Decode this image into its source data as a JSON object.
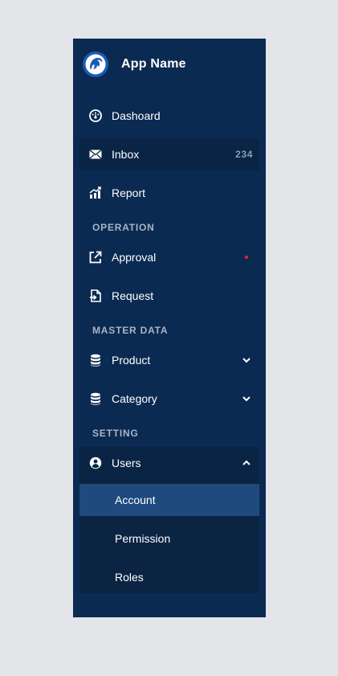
{
  "brand": {
    "name": "App Name",
    "logo_icon": "dolphin-logo-icon"
  },
  "colors": {
    "sidebar_bg": "#0b2a52",
    "active_bg": "#0a2445",
    "selected_bg": "#1e4a80",
    "badge_dot": "#e02a2a",
    "page_bg": "#e4e5e9"
  },
  "nav": {
    "dashboard": {
      "label": "Dashoard",
      "icon": "dashboard-gauge-icon"
    },
    "inbox": {
      "label": "Inbox",
      "count": "234",
      "icon": "envelope-icon"
    },
    "report": {
      "label": "Report",
      "icon": "chart-icon"
    }
  },
  "sections": {
    "operation": "OPERATION",
    "master_data": "MASTER DATA",
    "setting": "SETTING"
  },
  "operation": {
    "approval": {
      "label": "Approval",
      "icon": "external-link-icon"
    },
    "request": {
      "label": "Request",
      "icon": "file-arrow-icon"
    }
  },
  "master": {
    "product": {
      "label": "Product",
      "icon": "database-icon"
    },
    "category": {
      "label": "Category",
      "icon": "database-icon"
    }
  },
  "setting": {
    "users": {
      "label": "Users",
      "icon": "user-circle-icon"
    },
    "sub": [
      "Account",
      "Permission",
      "Roles"
    ]
  }
}
